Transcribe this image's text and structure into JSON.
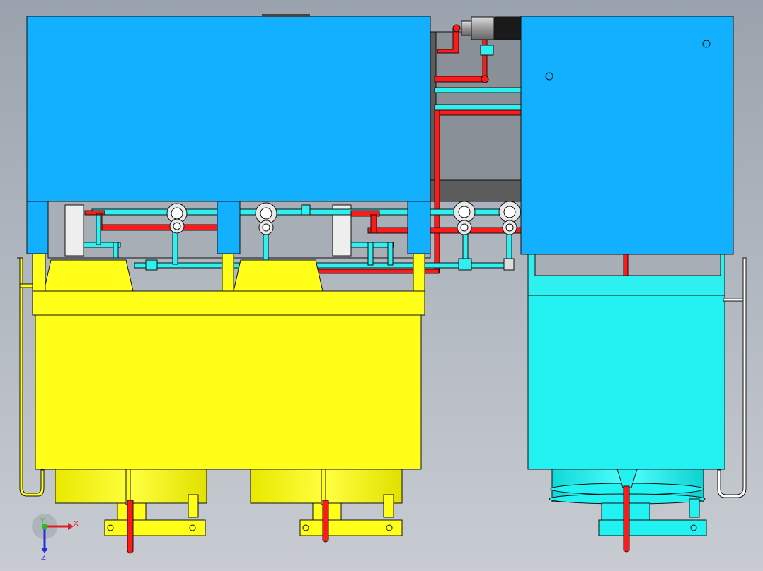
{
  "viewport": {
    "background_top": "#9aa3ad",
    "background_bottom": "#c8ccd2"
  },
  "colors": {
    "blue_panel": "#12b0ff",
    "yellow_body": "#ffff1a",
    "cyan_body": "#22f2f2",
    "hot_pipe": "#ff1a1a",
    "cold_pipe": "#2ff0f0",
    "frame_gray": "#5c5c5c",
    "outline": "#111111"
  },
  "axis_triad": {
    "x_label": "X",
    "y_label": "Y",
    "z_label": "Z",
    "x_color": "#e02020",
    "y_color": "#20c020",
    "z_color": "#2030e0"
  }
}
